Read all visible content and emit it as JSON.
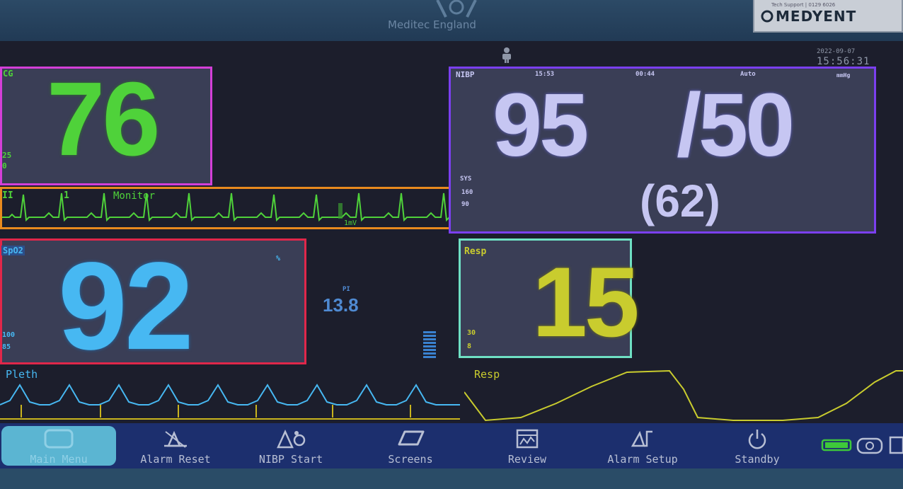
{
  "device": {
    "brand": "Meditec England",
    "badge_text": "MEDYENT",
    "badge_small": "Tech Support | 0129 6026"
  },
  "status": {
    "date": "2022-09-07",
    "time": "15:56:31"
  },
  "ecg": {
    "label": "CG",
    "value": "76",
    "limit_high": "25",
    "limit_low": "0",
    "color": "#4fd23a"
  },
  "ecg_wave": {
    "lead": "II",
    "gain": "1",
    "mode": "Monitor",
    "scale": "1mV",
    "color": "#4fd23a"
  },
  "nibp": {
    "label": "NIBP",
    "time": "15:53",
    "interval": "00:44",
    "mode": "Auto",
    "unit": "mmHg",
    "systolic": "95",
    "diastolic": "/50",
    "mean": "(62)",
    "sys_label": "SYS",
    "limit_high": "160",
    "limit_low": "90",
    "color": "#c6c6f2"
  },
  "spo2": {
    "label": "SpO2",
    "unit": "%",
    "value": "92",
    "limit_high": "100",
    "limit_low": "85",
    "color": "#47b8f2"
  },
  "pi": {
    "label": "PI",
    "value": "13.8",
    "color": "#4f8ad2"
  },
  "resp": {
    "label": "Resp",
    "value": "15",
    "limit_high": "30",
    "limit_low": "8",
    "color": "#c9cc2e"
  },
  "pleth_wave": {
    "label": "Pleth",
    "color": "#47b8f2"
  },
  "resp_wave": {
    "label": "Resp",
    "color": "#c9cc2e"
  },
  "softkeys": [
    {
      "label": "Main Menu",
      "icon": "monitor-icon"
    },
    {
      "label": "Alarm Reset",
      "icon": "bell-off-icon"
    },
    {
      "label": "NIBP Start",
      "icon": "cuff-icon"
    },
    {
      "label": "Screens",
      "icon": "screens-icon"
    },
    {
      "label": "Review",
      "icon": "review-icon"
    },
    {
      "label": "Alarm Setup",
      "icon": "alarm-setup-icon"
    },
    {
      "label": "Standby",
      "icon": "power-icon"
    }
  ]
}
